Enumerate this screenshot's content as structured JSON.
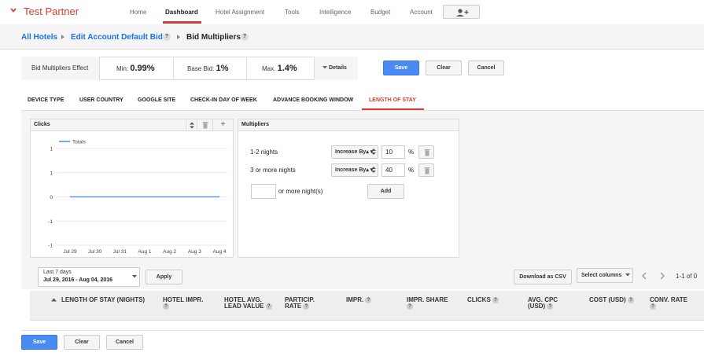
{
  "header": {
    "brand": "Test Partner",
    "nav": [
      "Home",
      "Dashboard",
      "Hotel Assignment",
      "Tools",
      "Intelligence",
      "Budget",
      "Account"
    ],
    "active_nav": "Dashboard"
  },
  "breadcrumb": {
    "items": [
      "All Hotels",
      "Edit Account Default Bid",
      "Bid Multipliers"
    ]
  },
  "effect": {
    "label": "Bid Multipliers Effect",
    "min_label": "Min:",
    "min_value": "0.99%",
    "base_label": "Base Bid:",
    "base_value": "1%",
    "max_label": "Max.",
    "max_value": "1.4%",
    "details": "Details"
  },
  "actions": {
    "save": "Save",
    "clear": "Clear",
    "cancel": "Cancel"
  },
  "tabs": [
    "DEVICE TYPE",
    "USER COUNTRY",
    "GOOGLE SITE",
    "CHECK-IN DAY OF WEEK",
    "ADVANCE BOOKING WINDOW",
    "LENGTH OF STAY"
  ],
  "active_tab": "LENGTH OF STAY",
  "chart_panel": {
    "metric": "Clicks",
    "add": "+"
  },
  "chart_data": {
    "type": "line",
    "categories": [
      "Jul 29",
      "Jul 30",
      "Jul 31",
      "Aug 1",
      "Aug 2",
      "Aug 3",
      "Aug 4"
    ],
    "series": [
      {
        "name": "Totals",
        "values": [
          0,
          0,
          0,
          0,
          0,
          0,
          0
        ]
      }
    ],
    "yticks": [
      "1",
      "1",
      "0",
      "-1",
      "-1"
    ],
    "ylim": [
      -1,
      1
    ],
    "legend": "top-left",
    "grid": true,
    "color": "#4a8af4"
  },
  "multipliers": {
    "title": "Multipliers",
    "rows": [
      {
        "label": "1-2 nights",
        "op": "Increase By",
        "value": "10",
        "unit": "%"
      },
      {
        "label": "3 or more nights",
        "op": "Increase By",
        "value": "40",
        "unit": "%"
      }
    ],
    "new_row_label": "or more night(s)",
    "add": "Add"
  },
  "date_range": {
    "preset": "Last 7 days",
    "range": "Jul 29, 2016 - Aug 04, 2016",
    "apply": "Apply"
  },
  "table_tools": {
    "download": "Download as CSV",
    "select_columns": "Select columns",
    "paging": "1-1 of 0"
  },
  "table": {
    "columns": [
      {
        "label": "LENGTH OF STAY (NIGHTS)",
        "help": false
      },
      {
        "label": "HOTEL IMPR.",
        "help": true
      },
      {
        "label": "HOTEL AVG. LEAD VALUE",
        "help": true
      },
      {
        "label": "PARTICIP. RATE",
        "help": true
      },
      {
        "label": "IMPR.",
        "help": true
      },
      {
        "label": "IMPR. SHARE",
        "help": true
      },
      {
        "label": "CLICKS",
        "help": true
      },
      {
        "label": "AVG. CPC (USD)",
        "help": true
      },
      {
        "label": "COST (USD)",
        "help": true
      },
      {
        "label": "CONV. RATE",
        "help": true
      }
    ]
  },
  "help_glyph": "?"
}
